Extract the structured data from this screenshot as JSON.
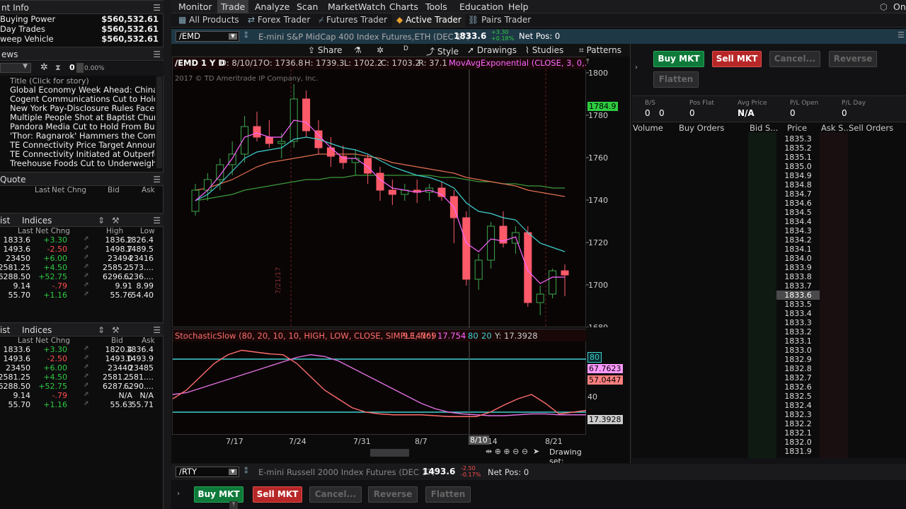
{
  "left": {
    "account_title": "nt Info",
    "buying_power_label": "Buying Power",
    "buying_power": "$560,532.61",
    "day_trades_label": "Day Trades",
    "day_trades": "$560,532.61",
    "sweep_label": "weep Vehicle",
    "sweep": "$560,532.61",
    "news_title": "ews",
    "news_toolbar": {
      "count": "0",
      "percent": "0.00%"
    },
    "news_header": "Title (Click for story)",
    "news": [
      "Global Economy Week Ahead: China I...",
      "Cogent Communications Cut to Hold F...",
      "New York Pay-Disclosure Rules Face P...",
      "Multiple People Shot at Baptist Church...",
      "Pandora Media Cut to Hold From Buy ...",
      "'Thor: Ragnarok' Hammers the Compei...",
      "TE Connectivity Price Target Announce...",
      "TE Connectivity Initiated at Outperfor...",
      "Treehouse Foods Cut to Underweight ..."
    ],
    "quote_title": "Quote",
    "quote_cols": [
      "Last",
      "Net Chng",
      "Bid",
      "Ask"
    ],
    "list1_title": "ist",
    "list1_name": "Indices",
    "list1_cols": [
      "Last",
      "Net Chng",
      "High",
      "Low"
    ],
    "list1": [
      [
        "1833.6",
        "+3.30",
        "1836.2",
        "1826.4"
      ],
      [
        "1493.6",
        "-2.50",
        "1498.7",
        "1489.5"
      ],
      [
        "23450",
        "+6.00",
        "23494",
        "23416"
      ],
      [
        "2581.25",
        "+4.50",
        "2585....",
        "2573...."
      ],
      [
        "6288.50",
        "+52.75",
        "6296....",
        "6236...."
      ],
      [
        "9.14",
        "-.79",
        "9.91",
        "8.99"
      ],
      [
        "55.70",
        "+1.16",
        "55.76",
        "54.40"
      ]
    ],
    "list2_title": "ist",
    "list2_name": "Indices",
    "list2_cols": [
      "Last",
      "Net Chng",
      "Bid",
      "Ask"
    ],
    "list2": [
      [
        "1833.6",
        "+3.30",
        "1820.4",
        "1836.4"
      ],
      [
        "1493.6",
        "-2.50",
        "1493.0",
        "1493.9"
      ],
      [
        "23450",
        "+6.00",
        "23440",
        "23485"
      ],
      [
        "2581.25",
        "+4.50",
        "2581....",
        "2581...."
      ],
      [
        "6288.50",
        "+52.75",
        "6287....",
        "6290...."
      ],
      [
        "9.14",
        "-.79",
        "N/A",
        "N/A"
      ],
      [
        "55.70",
        "+1.16",
        "55.63",
        "55.71"
      ]
    ]
  },
  "menu": [
    "Monitor",
    "Trade",
    "Analyze",
    "Scan",
    "MarketWatch",
    "Charts",
    "Tools",
    "Education",
    "Help"
  ],
  "menu_right": "On",
  "tabs": [
    "All Products",
    "Forex Trader",
    "Futures Trader",
    "Active Trader",
    "Pairs Trader"
  ],
  "symbar": {
    "symbol": "/EMD",
    "desc": "E-mini S&P MidCap 400 Index Futures,ETH (DEC 17)",
    "last": "1833.6",
    "chg": "+3.30",
    "pct": "+0.18%",
    "netpos": "Net Pos: 0"
  },
  "chartbar": {
    "share": "Share",
    "style": "Style",
    "drawings": "Drawings",
    "studies": "Studies",
    "patterns": "Patterns"
  },
  "chart": {
    "info": "/EMD 1 Y D",
    "date": "D: 8/10/17",
    "o": "O: 1736.8",
    "h": "H: 1739.3",
    "l": "L: 1702.2",
    "c": "C: 1703.2",
    "r": "R: 37.1",
    "study": "MovAvgExponential (CLOSE, 3, 0,...",
    "copyright": "2017 © TD Ameritrade IP Company, Inc.",
    "marker": "7/21/17",
    "last_tag": "1784.9",
    "stoch_label": "StochasticSlow (80, 20, 10, 10, HIGH, LOW, CLOSE, SIMPLE, No)",
    "stoch_v1": "9.14769",
    "stoch_v2": "17.754",
    "stoch_80": "80",
    "stoch_20": "20",
    "stoch_y": "Y: 17.3928",
    "stoch_tags": [
      "80",
      "67.7623",
      "57.0447",
      "40",
      "17.3928"
    ],
    "drawing_set": "Drawing set: Default",
    "x_cursor": "8/10"
  },
  "chart_data": {
    "type": "candlestick",
    "y_ticks": [
      1800,
      1780,
      1760,
      1740,
      1720,
      1700,
      1680
    ],
    "x_ticks": [
      "7/17",
      "7/24",
      "7/31",
      "8/7",
      "8/14",
      "8/21"
    ],
    "candles": [
      [
        1735,
        1748,
        1733,
        1745
      ],
      [
        1745,
        1753,
        1740,
        1750
      ],
      [
        1750,
        1760,
        1745,
        1757
      ],
      [
        1757,
        1768,
        1752,
        1762
      ],
      [
        1762,
        1780,
        1758,
        1775
      ],
      [
        1775,
        1782,
        1768,
        1770
      ],
      [
        1770,
        1778,
        1765,
        1767
      ],
      [
        1767,
        1772,
        1760,
        1768
      ],
      [
        1768,
        1795,
        1765,
        1788
      ],
      [
        1788,
        1792,
        1770,
        1773
      ],
      [
        1773,
        1778,
        1762,
        1765
      ],
      [
        1765,
        1770,
        1756,
        1761
      ],
      [
        1761,
        1766,
        1755,
        1758
      ],
      [
        1758,
        1764,
        1752,
        1760
      ],
      [
        1760,
        1762,
        1748,
        1753
      ],
      [
        1753,
        1756,
        1740,
        1745
      ],
      [
        1745,
        1750,
        1738,
        1743
      ],
      [
        1743,
        1748,
        1740,
        1745
      ],
      [
        1745,
        1750,
        1739,
        1744
      ],
      [
        1744,
        1748,
        1740,
        1746
      ],
      [
        1746,
        1749,
        1740,
        1742
      ],
      [
        1742,
        1745,
        1720,
        1732
      ],
      [
        1732,
        1735,
        1700,
        1703
      ],
      [
        1703,
        1715,
        1698,
        1712
      ],
      [
        1712,
        1730,
        1708,
        1728
      ],
      [
        1728,
        1735,
        1718,
        1720
      ],
      [
        1720,
        1728,
        1715,
        1725
      ],
      [
        1725,
        1728,
        1690,
        1692
      ],
      [
        1692,
        1700,
        1686,
        1696
      ],
      [
        1696,
        1708,
        1694,
        1707
      ],
      [
        1707,
        1710,
        1695,
        1705
      ]
    ],
    "ema_fast": [
      1740,
      1745,
      1752,
      1760,
      1770,
      1772,
      1770,
      1770,
      1778,
      1777,
      1771,
      1765,
      1760,
      1760,
      1756,
      1750,
      1746,
      1745,
      1744,
      1745,
      1743,
      1737,
      1720,
      1716,
      1722,
      1721,
      1723,
      1707,
      1701,
      1704,
      1704
    ],
    "ema_slow": [
      1740,
      1743,
      1748,
      1754,
      1760,
      1763,
      1764,
      1765,
      1769,
      1770,
      1769,
      1767,
      1765,
      1764,
      1762,
      1759,
      1756,
      1754,
      1752,
      1751,
      1749,
      1746,
      1739,
      1735,
      1734,
      1732,
      1731,
      1725,
      1720,
      1718,
      1716
    ],
    "sma": [
      1745,
      1746,
      1748,
      1750,
      1753,
      1756,
      1758,
      1759,
      1760,
      1761,
      1762,
      1762,
      1762,
      1762,
      1761,
      1760,
      1758,
      1757,
      1756,
      1755,
      1754,
      1753,
      1751,
      1750,
      1749,
      1748,
      1747,
      1745,
      1744,
      1743,
      1742
    ],
    "sma2": [
      1740,
      1741,
      1742,
      1743,
      1745,
      1746,
      1747,
      1748,
      1749,
      1750,
      1750,
      1751,
      1751,
      1752,
      1752,
      1752,
      1752,
      1752,
      1752,
      1752,
      1751,
      1751,
      1750,
      1749,
      1749,
      1748,
      1748,
      1747,
      1747,
      1746,
      1746
    ],
    "stoch_k": [
      35,
      45,
      60,
      75,
      85,
      90,
      88,
      86,
      85,
      75,
      60,
      45,
      35,
      25,
      20,
      18,
      17,
      17,
      17,
      16,
      15,
      15,
      15,
      20,
      28,
      35,
      40,
      30,
      18,
      20,
      22
    ],
    "stoch_d": [
      40,
      42,
      47,
      52,
      57,
      62,
      67,
      72,
      77,
      82,
      85,
      83,
      78,
      70,
      62,
      54,
      46,
      38,
      30,
      24,
      20,
      18,
      17,
      16,
      16,
      17,
      18,
      18,
      17,
      17,
      17
    ]
  },
  "right": {
    "buy_mkt": "Buy MKT",
    "sell_mkt": "Sell MKT",
    "cancel": "Cancel...",
    "reverse": "Reverse",
    "flatten": "Flatten",
    "stats": [
      {
        "label": "B/S",
        "value": "0",
        "value2": "0"
      },
      {
        "label": "Pos Flat",
        "value": "0"
      },
      {
        "label": "Avg Price",
        "value": "N/A"
      },
      {
        "label": "P/L Open",
        "value": "0"
      },
      {
        "label": "P/L Day",
        "value": "0"
      }
    ],
    "ladder_cols": [
      "Volume",
      "Buy Orders",
      "Bid S...",
      "Price",
      "Ask S...",
      "Sell Orders"
    ],
    "prices": [
      "1835.3",
      "1835.2",
      "1835.1",
      "1835.0",
      "1834.9",
      "1834.8",
      "1834.7",
      "1834.6",
      "1834.5",
      "1834.4",
      "1834.3",
      "1834.2",
      "1834.1",
      "1834.0",
      "1833.9",
      "1833.8",
      "1833.7",
      "1833.6",
      "1833.5",
      "1833.4",
      "1833.3",
      "1833.2",
      "1833.1",
      "1833.0",
      "1832.9",
      "1832.8",
      "1832.7",
      "1832.6",
      "1832.5",
      "1832.4",
      "1832.3",
      "1832.2",
      "1832.1",
      "1832.0",
      "1831.9"
    ],
    "current_price": "1833.6"
  },
  "bottom": {
    "symbol": "/RTY",
    "desc": "E-mini Russell 2000 Index Futures (DEC 17)",
    "last": "1493.6",
    "chg": "-2.50",
    "pct": "-0.17%",
    "netpos": "Net Pos: 0",
    "buy_mkt": "Buy MKT",
    "sell_mkt": "Sell MKT",
    "cancel": "Cancel...",
    "reverse": "Reverse",
    "flatten": "Flatten"
  },
  "colors": {
    "up": "#2ecc40",
    "down": "#ff4d4d",
    "candle_up": "#1a7a2a",
    "candle_down": "#ff5a6a",
    "ema_fast": "#ff66ff",
    "ema_slow": "#3fd0d0",
    "sma": "#e07050",
    "sma2": "#3a9a3a"
  }
}
